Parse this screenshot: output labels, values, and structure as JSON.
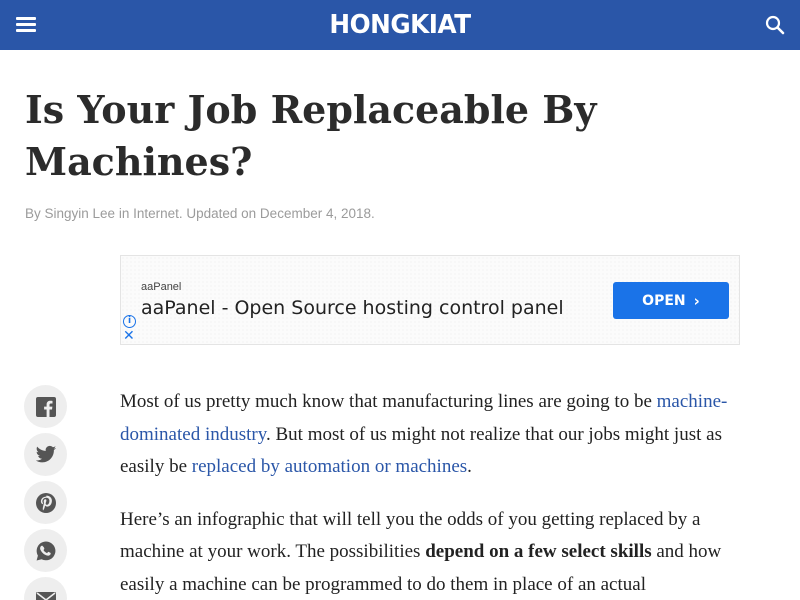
{
  "header": {
    "logo": "HONGKIAT",
    "menu_icon": "hamburger-menu-icon",
    "search_icon": "search-icon",
    "bg_color": "#2a56a8"
  },
  "article": {
    "title": "Is Your Job Replaceable By Machines?",
    "meta": {
      "by": "By ",
      "author": "Singyin Lee",
      "in": " in ",
      "category": "Internet",
      "updated": ". Updated on December 4, 2018."
    },
    "p1": {
      "t1": "Most of us pretty much know that manufacturing lines are going to be ",
      "link1": "machine-dominated industry",
      "t2": ". But most of us might not realize that our jobs might just as easily be ",
      "link2": "replaced by automation or machines",
      "t3": "."
    },
    "p2": {
      "t1": "Here’s an infographic that will tell you the odds of you getting replaced by a machine at your work. The possibilities ",
      "bold": "depend on a few select skills",
      "t2": " and how easily a machine can be programmed to do them in place of an actual"
    }
  },
  "ad": {
    "advertiser": "aaPanel",
    "headline": "aaPanel - Open Source hosting control panel",
    "cta": "OPEN",
    "cta_color": "#1a73e8",
    "info_icon": "ad-info-icon",
    "close_icon": "ad-close-icon"
  },
  "share": [
    {
      "name": "facebook",
      "icon": "facebook-icon"
    },
    {
      "name": "twitter",
      "icon": "twitter-icon"
    },
    {
      "name": "pinterest",
      "icon": "pinterest-icon"
    },
    {
      "name": "whatsapp",
      "icon": "whatsapp-icon"
    },
    {
      "name": "email",
      "icon": "email-icon"
    }
  ]
}
